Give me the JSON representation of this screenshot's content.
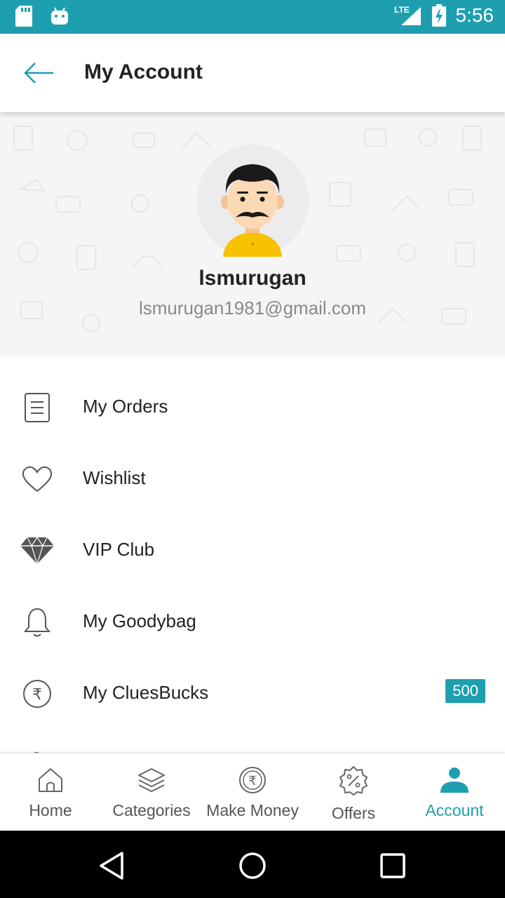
{
  "status_bar": {
    "network": "LTE",
    "time": "5:56",
    "icons": [
      "sd-card-icon",
      "android-icon",
      "lte-signal-icon",
      "battery-charging-icon"
    ]
  },
  "app_bar": {
    "title": "My Account",
    "back_icon": "arrow-left-icon"
  },
  "profile": {
    "name": "lsmurugan",
    "email": "lsmurugan1981@gmail.com",
    "avatar_icon": "man-avatar-icon"
  },
  "menu": {
    "items": [
      {
        "label": "My Orders",
        "icon": "orders-list-icon"
      },
      {
        "label": "Wishlist",
        "icon": "heart-icon"
      },
      {
        "label": "VIP Club",
        "icon": "diamond-icon"
      },
      {
        "label": "My Goodybag",
        "icon": "bell-icon"
      },
      {
        "label": "My CluesBucks",
        "icon": "rupee-icon",
        "badge": "500"
      }
    ]
  },
  "bottom_nav": {
    "items": [
      {
        "label": "Home",
        "icon": "home-icon"
      },
      {
        "label": "Categories",
        "icon": "layers-icon"
      },
      {
        "label": "Make Money",
        "icon": "rupee-coin-icon"
      },
      {
        "label": "Offers",
        "icon": "offer-badge-icon"
      },
      {
        "label": "Account",
        "icon": "person-icon",
        "active": true
      }
    ]
  },
  "colors": {
    "accent": "#1e9fb0",
    "status_bar": "#1e9fb0",
    "avatar_shirt": "#f7c200",
    "text_primary": "#222222",
    "text_secondary": "#8a8a8a"
  }
}
